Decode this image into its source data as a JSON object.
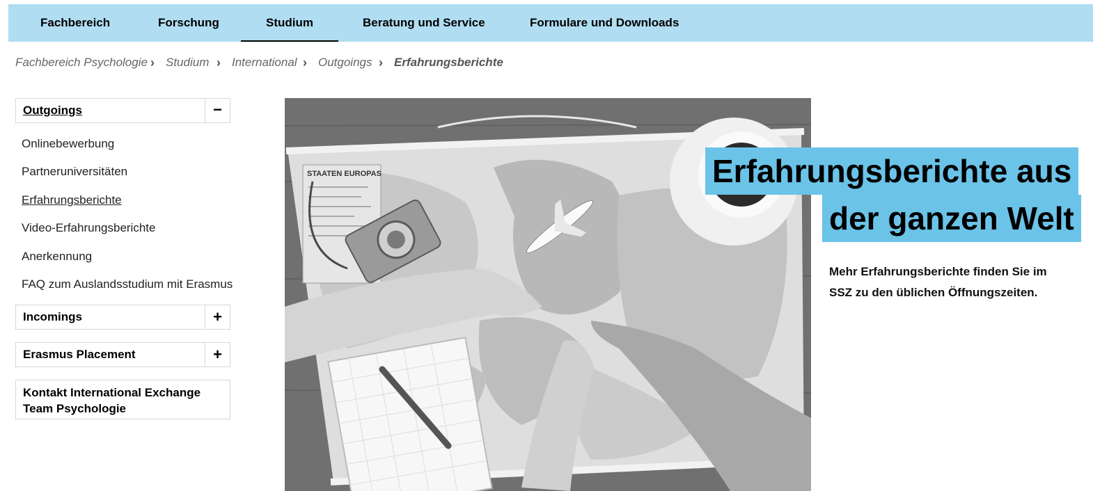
{
  "topnav": {
    "items": [
      {
        "label": "Fachbereich"
      },
      {
        "label": "Forschung"
      },
      {
        "label": "Studium",
        "active": true
      },
      {
        "label": "Beratung und Service"
      },
      {
        "label": "Formulare und Downloads"
      }
    ]
  },
  "breadcrumb": {
    "items": [
      "Fachbereich Psychologie",
      "Studium",
      "International",
      "Outgoings",
      "Erfahrungsberichte"
    ],
    "separator": "›"
  },
  "sidebar": {
    "outgoings": {
      "title": "Outgoings",
      "toggle": "−"
    },
    "links": [
      {
        "label": "Onlinebewerbung"
      },
      {
        "label": "Partneruniversitäten"
      },
      {
        "label": "Erfahrungsberichte",
        "current": true
      },
      {
        "label": "Video-Erfahrungsberichte"
      },
      {
        "label": "Anerkennung"
      },
      {
        "label": "FAQ zum Auslandsstudium mit Erasmus"
      }
    ],
    "incomings": {
      "title": "Incomings",
      "toggle": "+"
    },
    "erasmus": {
      "title": "Erasmus Placement",
      "toggle": "+"
    },
    "kontakt": {
      "line1": "Kontakt International Exchange",
      "line2": "Team Psychologie"
    }
  },
  "hero": {
    "map_title": "STAATEN EUROPAS"
  },
  "main": {
    "heading_line1": "Erfahrungsberichte aus",
    "heading_line2": "der ganzen Welt",
    "intro_line1": "Mehr Erfahrungsberichte finden Sie im",
    "intro_line2": "SSZ zu den üblichen Öffnungszeiten."
  },
  "colors": {
    "nav_bg": "#b0ddf1",
    "heading_bg": "#6bc3e8"
  }
}
